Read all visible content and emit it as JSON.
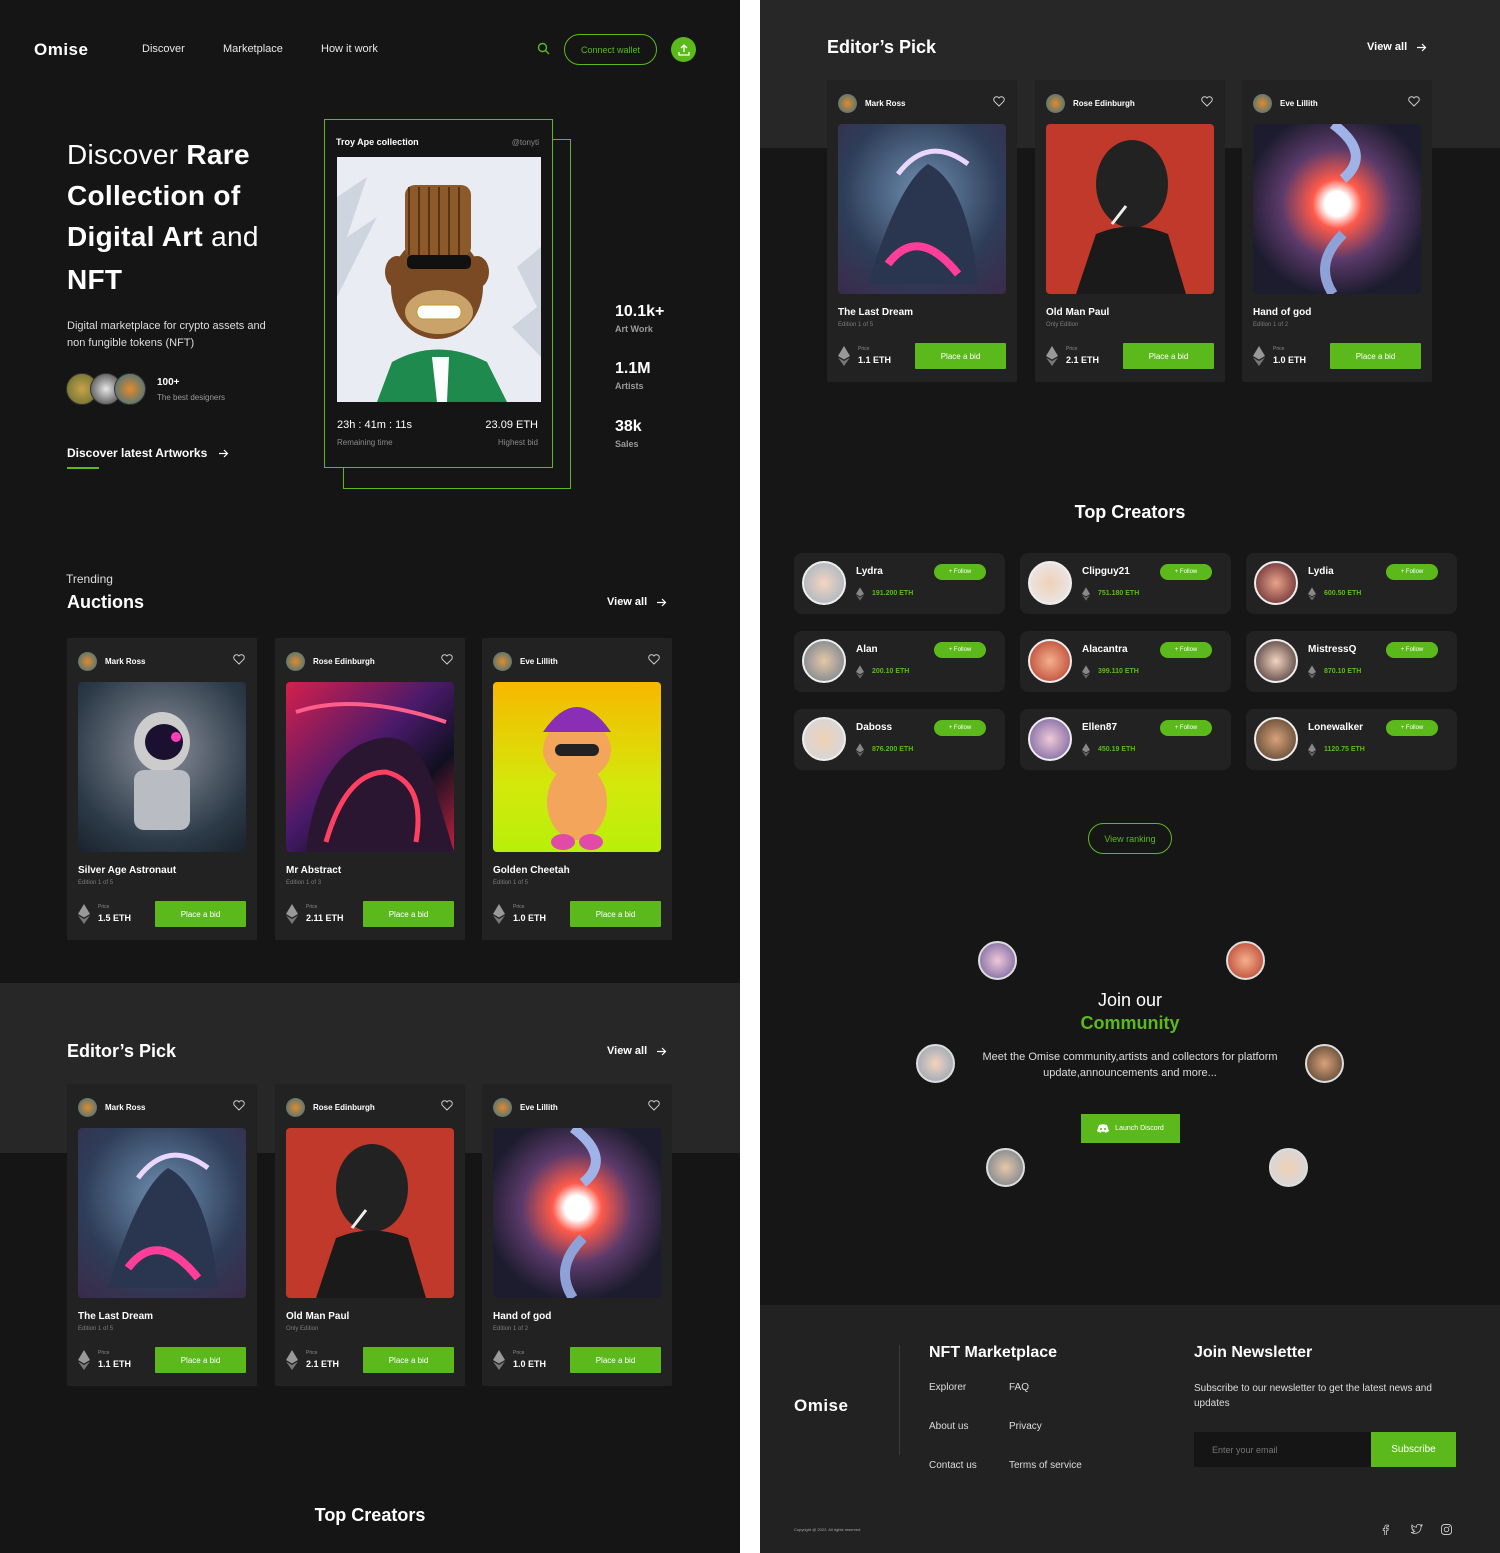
{
  "brand": "Omise",
  "nav": {
    "discover": "Discover",
    "marketplace": "Marketplace",
    "how": "How it work",
    "connect": "Connect wallet"
  },
  "hero": {
    "title_1": "Discover ",
    "title_1b": "Rare",
    "title_2": "Collection of",
    "title_3a": "Digital Art",
    "title_3b": " and",
    "title_4": "NFT",
    "subtitle": "Digital marketplace for crypto assets and non fungible tokens (NFT)",
    "designers_count": "100+",
    "designers_label": "The best designers",
    "cta": "Discover latest Artworks"
  },
  "feature": {
    "collection": "Troy Ape collection",
    "handle": "@tonyti",
    "timer": "23h : 41m : 11s",
    "timer_label": "Remaining time",
    "bid": "23.09 ETH",
    "bid_label": "Highest bid"
  },
  "stats": [
    {
      "value": "10.1k+",
      "label": "Art Work"
    },
    {
      "value": "1.1M",
      "label": "Artists"
    },
    {
      "value": "38k",
      "label": "Sales"
    }
  ],
  "trending": {
    "kicker": "Trending",
    "title": "Auctions",
    "view_all": "View all",
    "cards": [
      {
        "owner": "Mark Ross",
        "name": "Silver Age Astronaut",
        "edition": "Edition 1 of 5",
        "price_label": "Price",
        "price": "1.5 ETH",
        "bid": "Place a bid"
      },
      {
        "owner": "Rose Edinburgh",
        "name": "Mr Abstract",
        "edition": "Edition 1 of 3",
        "price_label": "Price",
        "price": "2.11 ETH",
        "bid": "Place a bid"
      },
      {
        "owner": "Eve Lillith",
        "name": "Golden Cheetah",
        "edition": "Edition 1 of 5",
        "price_label": "Price",
        "price": "1.0 ETH",
        "bid": "Place a bid"
      }
    ]
  },
  "editors": {
    "title": "Editor’s Pick",
    "view_all": "View all",
    "cards": [
      {
        "owner": "Mark Ross",
        "name": "The Last Dream",
        "edition": "Edition 1 of 5",
        "price_label": "Price",
        "price": "1.1 ETH",
        "bid": "Place a bid"
      },
      {
        "owner": "Rose Edinburgh",
        "name": "Old Man Paul",
        "edition": "Only Edition",
        "price_label": "Price",
        "price": "2.1 ETH",
        "bid": "Place a bid"
      },
      {
        "owner": "Eve Lillith",
        "name": "Hand of god",
        "edition": "Edition 1 of 2",
        "price_label": "Price",
        "price": "1.0 ETH",
        "bid": "Place a bid"
      }
    ]
  },
  "top_creators": {
    "title": "Top Creators",
    "follow": "+ Follow",
    "ranking": "View ranking",
    "list": [
      {
        "name": "Lydra",
        "eth": "191.200 ETH"
      },
      {
        "name": "Clipguy21",
        "eth": "751.180 ETH"
      },
      {
        "name": "Lydia",
        "eth": "600.50 ETH"
      },
      {
        "name": "Alan",
        "eth": "200.10 ETH"
      },
      {
        "name": "Alacantra",
        "eth": "399.110 ETH"
      },
      {
        "name": "MistressQ",
        "eth": "870.10 ETH"
      },
      {
        "name": "Daboss",
        "eth": "876.200 ETH"
      },
      {
        "name": "Ellen87",
        "eth": "450.19 ETH"
      },
      {
        "name": "Lonewalker",
        "eth": "1120.75 ETH"
      }
    ]
  },
  "community": {
    "title_1": "Join our",
    "title_2": "Community",
    "text": "Meet the Omise community,artists and collectors for platform update,announcements and more...",
    "button": "Launch Discord"
  },
  "footer": {
    "marketplace_title": "NFT Marketplace",
    "links": [
      "Explorer",
      "FAQ",
      "About us",
      "Privacy",
      "Contact us",
      "Terms of service"
    ],
    "newsletter_title": "Join Newsletter",
    "newsletter_text": "Subscribe to our newsletter to get the latest news and updates",
    "email_placeholder": "Enter your email",
    "subscribe": "Subscribe",
    "copyright": "Copyright @ 2022. All rights reserved"
  },
  "colors": {
    "accent": "#5cb91c",
    "bg": "#151515",
    "card": "#222222"
  }
}
